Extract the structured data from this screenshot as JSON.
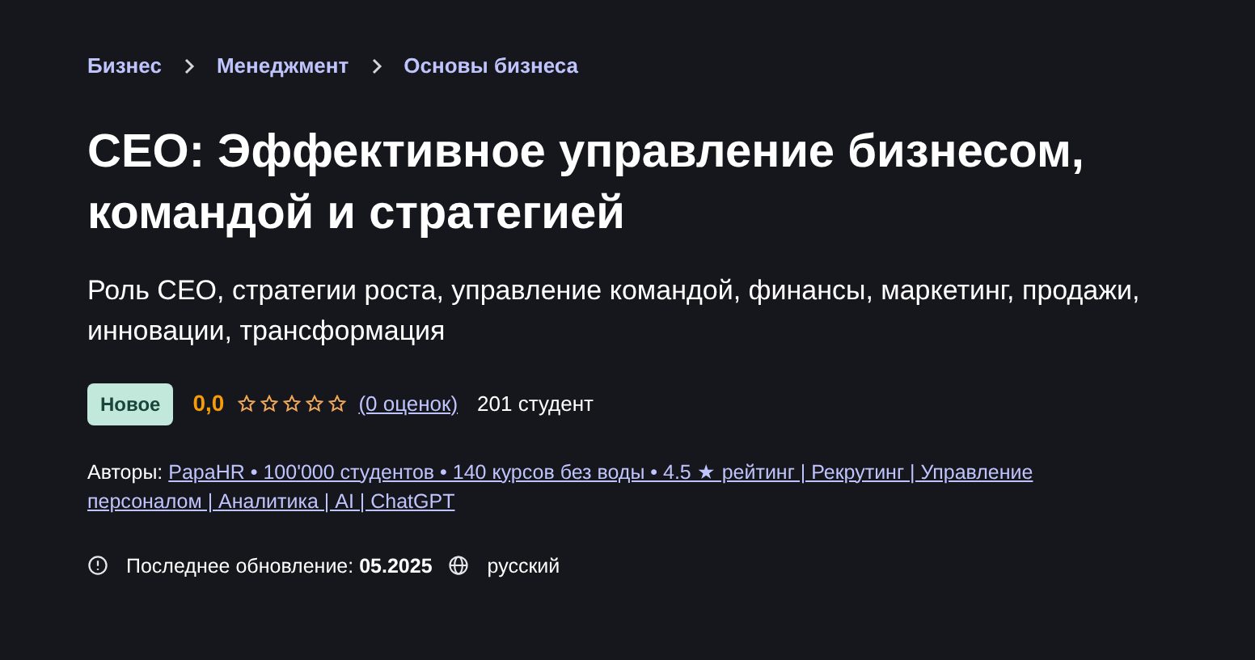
{
  "breadcrumbs": [
    "Бизнес",
    "Менеджмент",
    "Основы бизнеса"
  ],
  "title": "CEO: Эффективное управление бизнесом, командой и стратегией",
  "subtitle": "Роль CEO, стратегии роста, управление командой, финансы, маркетинг, продажи, инновации, трансформация",
  "badge": "Новое",
  "rating": "0,0",
  "stars": 0,
  "ratings_count": "(0 оценок)",
  "students": "201 студент",
  "authors_label": "Авторы:",
  "authors_link": "PapaHR • 100'000 студентов • 140 курсов без воды • 4.5 ★ рейтинг | Рекрутинг | Управление персоналом | Аналитика | AI | ChatGPT",
  "updated_label": "Последнее обновление:",
  "updated_value": "05.2025",
  "language": "русский"
}
